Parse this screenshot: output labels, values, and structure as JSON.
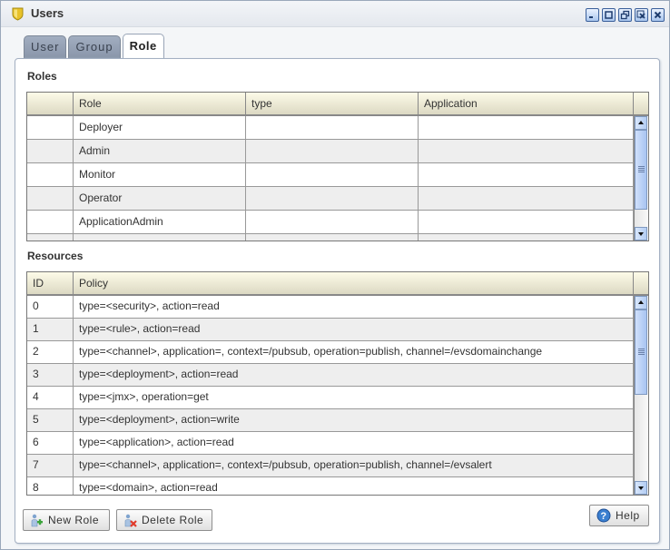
{
  "window": {
    "title": "Users",
    "controls": [
      "minimize",
      "maximize",
      "restore",
      "close-others",
      "close"
    ]
  },
  "tabs": [
    {
      "label": "User",
      "active": false
    },
    {
      "label": "Group",
      "active": false
    },
    {
      "label": "Role",
      "active": true
    }
  ],
  "roles": {
    "section_label": "Roles",
    "columns": [
      "",
      "Role",
      "type",
      "Application"
    ],
    "rows": [
      {
        "selector": "",
        "role": "Deployer",
        "type": "",
        "application": ""
      },
      {
        "selector": "",
        "role": "Admin",
        "type": "",
        "application": ""
      },
      {
        "selector": "",
        "role": "Monitor",
        "type": "",
        "application": ""
      },
      {
        "selector": "",
        "role": "Operator",
        "type": "",
        "application": ""
      },
      {
        "selector": "",
        "role": "ApplicationAdmin",
        "type": "",
        "application": ""
      }
    ]
  },
  "resources": {
    "section_label": "Resources",
    "columns": [
      "ID",
      "Policy"
    ],
    "rows": [
      {
        "id": "0",
        "policy": "type=<security>, action=read"
      },
      {
        "id": "1",
        "policy": "type=<rule>, action=read"
      },
      {
        "id": "2",
        "policy": "type=<channel>, application=, context=/pubsub, operation=publish, channel=/evsdomainchange"
      },
      {
        "id": "3",
        "policy": "type=<deployment>, action=read"
      },
      {
        "id": "4",
        "policy": "type=<jmx>, operation=get"
      },
      {
        "id": "5",
        "policy": "type=<deployment>, action=write"
      },
      {
        "id": "6",
        "policy": "type=<application>, action=read"
      },
      {
        "id": "7",
        "policy": "type=<channel>, application=, context=/pubsub, operation=publish, channel=/evsalert"
      },
      {
        "id": "8",
        "policy": "type=<domain>, action=read"
      }
    ]
  },
  "buttons": {
    "new_role": "New Role",
    "delete_role": "Delete Role",
    "help": "Help"
  },
  "colors": {
    "header_accent": "#dcd9c3",
    "scrollbar": "#a8c4f1",
    "tab_inactive": "#8996aa"
  }
}
